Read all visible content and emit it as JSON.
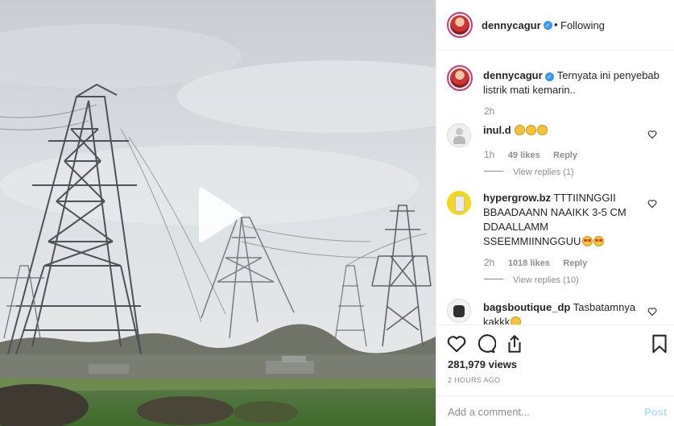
{
  "post": {
    "author": "dennycagur",
    "follow_status": "Following",
    "caption": "Ternyata ini penyebab listrik mati kemarin..",
    "caption_time": "2h",
    "views": "281,979 views",
    "posted_ago": "2 HOURS AGO"
  },
  "header": {
    "dot": "•"
  },
  "comments": [
    {
      "username": "inul.d",
      "text": "",
      "emoji_count": 3,
      "time": "1h",
      "likes": "49 likes",
      "reply_label": "Reply",
      "view_replies": "View replies (1)"
    },
    {
      "username": "hypergrow.bz",
      "text": "TTTIINNGGII BBAADAANN NAAIKK 3-5 CM DDAALLAMM SSEEMMIINNGGUU",
      "time": "2h",
      "likes": "1018 likes",
      "reply_label": "Reply",
      "view_replies": "View replies (10)"
    },
    {
      "username": "bagsboutique_dp",
      "text": "Tasbatamnya kakkk"
    }
  ],
  "composer": {
    "placeholder": "Add a comment...",
    "post_label": "Post"
  },
  "icons": {
    "play": "play-icon",
    "like": "heart-icon",
    "comment": "comment-icon",
    "share": "share-icon",
    "save": "bookmark-icon",
    "verified": "verified-badge-icon"
  },
  "colors": {
    "verified": "#3897f0",
    "post_disabled": "#b2dffc",
    "muted": "#8e8e8e",
    "story_ring": "#e1306c"
  }
}
